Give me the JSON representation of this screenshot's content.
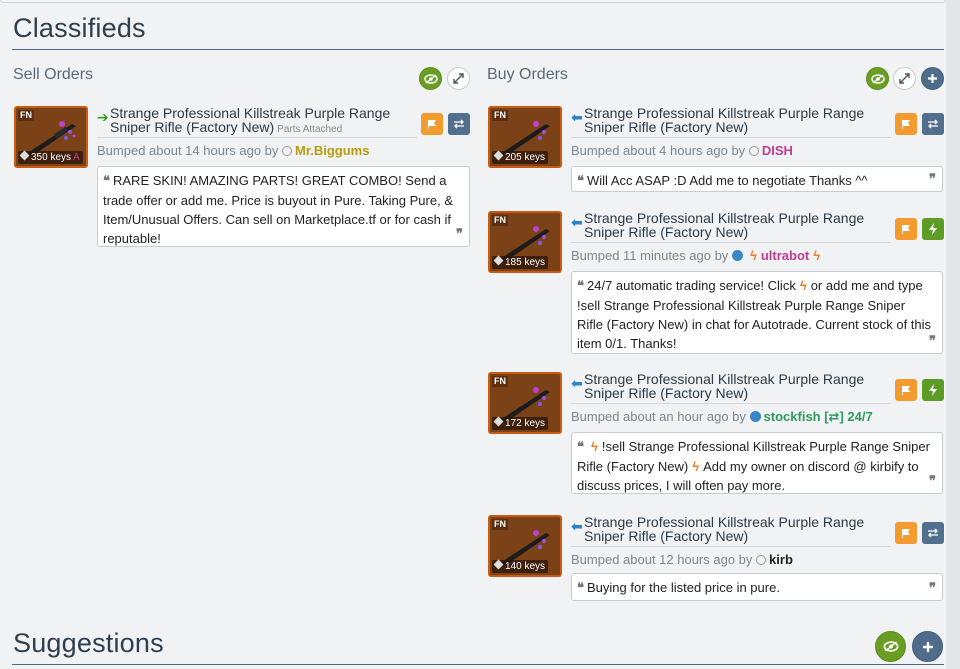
{
  "classifieds": {
    "title": "Classifieds"
  },
  "sell_orders": {
    "title": "Sell Orders",
    "listings": [
      {
        "quality_badge": "FN",
        "price": "350 keys",
        "price_effect": "A",
        "item_name": "Strange Professional Killstreak Purple Range Sniper Rifle (Factory New)",
        "parts_label": "Parts Attached",
        "bumped_text": "Bumped about 14 hours ago by",
        "user": "Mr.Biggums",
        "user_color": "#b69d0e",
        "comment": "RARE SKIN! AMAZING PARTS! GREAT COMBO! Send a trade offer or add me. Price is buyout in Pure. Taking Pure, & Item/Unusual Offers. Can sell on Marketplace.tf or for cash if reputable!"
      }
    ]
  },
  "buy_orders": {
    "title": "Buy Orders",
    "listings": [
      {
        "quality_badge": "FN",
        "price": "205 keys",
        "item_name": "Strange Professional Killstreak Purple Range Sniper Rifle (Factory New)",
        "bumped_text": "Bumped about 4 hours ago by",
        "user": "DISH",
        "user_color": "#c23c8f",
        "comment": "Will Acc ASAP :D Add me to negotiate Thanks ^^"
      },
      {
        "quality_badge": "FN",
        "price": "185 keys",
        "item_name": "Strange Professional Killstreak Purple Range Sniper Rifle (Factory New)",
        "bumped_text": "Bumped 11 minutes ago by",
        "user": "ultrabot",
        "user_color": "#c23c8f",
        "comment_before": "24/7 automatic trading service! Click",
        "comment_after": "or add me and type !sell Strange Professional Killstreak Purple Range Sniper Rifle (Factory New) in chat for Autotrade. Current stock of this item 0/1. Thanks!"
      },
      {
        "quality_badge": "FN",
        "price": "172 keys",
        "item_name": "Strange Professional Killstreak Purple Range Sniper Rifle (Factory New)",
        "bumped_text": "Bumped about an hour ago by",
        "user": "stockfish [⇄] 24/7",
        "user_color": "#2f9a5e",
        "comment_part1": "!sell Strange Professional Killstreak Purple Range Sniper Rifle (Factory New)",
        "comment_part2": "Add my owner on discord @ kirbify to discuss prices, I will often pay more."
      },
      {
        "quality_badge": "FN",
        "price": "140 keys",
        "item_name": "Strange Professional Killstreak Purple Range Sniper Rifle (Factory New)",
        "bumped_text": "Bumped about 12 hours ago by",
        "user": "kirb",
        "user_color": "#222222",
        "comment": "Buying for the listed price in pure."
      }
    ]
  },
  "suggestions": {
    "title": "Suggestions"
  },
  "colors": {
    "accent_green": "#6a9d24",
    "accent_orange": "#f39b2e",
    "accent_slate": "#52708d",
    "item_border": "#c85d12"
  }
}
